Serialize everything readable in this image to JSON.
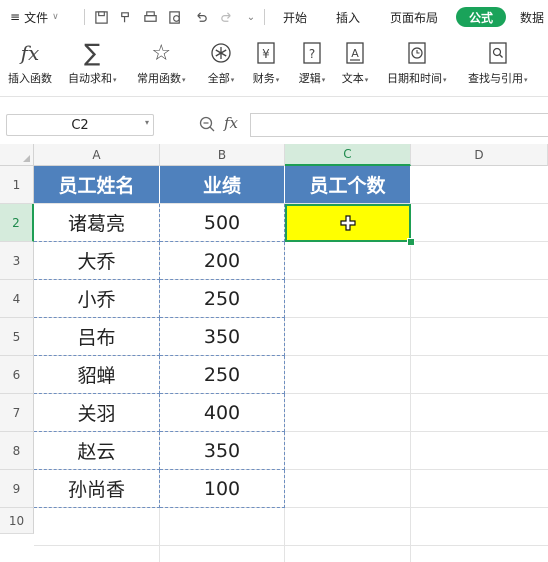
{
  "menubar": {
    "file_label": "文件",
    "tabs": [
      "开始",
      "插入",
      "页面布局",
      "公式",
      "数据"
    ],
    "active_tab": "公式",
    "quick_access": [
      "save-icon",
      "format-painter-icon",
      "print-icon",
      "print-preview-icon",
      "undo-icon",
      "redo-icon",
      "more-icon"
    ]
  },
  "ribbon": {
    "buttons": [
      {
        "label": "插入函数",
        "icon": "fx-icon",
        "dropdown": false
      },
      {
        "label": "自动求和",
        "icon": "sigma-icon",
        "dropdown": true
      },
      {
        "label": "常用函数",
        "icon": "star-icon",
        "dropdown": true
      },
      {
        "label": "全部",
        "icon": "asterisk-icon",
        "dropdown": true
      },
      {
        "label": "财务",
        "icon": "yen-icon",
        "dropdown": true
      },
      {
        "label": "逻辑",
        "icon": "question-icon",
        "dropdown": true
      },
      {
        "label": "文本",
        "icon": "text-icon",
        "dropdown": true
      },
      {
        "label": "日期和时间",
        "icon": "clock-icon",
        "dropdown": true
      },
      {
        "label": "查找与引用",
        "icon": "search-reference-icon",
        "dropdown": true
      }
    ]
  },
  "formula_bar": {
    "name_box": "C2",
    "fx_label": "fx",
    "formula": ""
  },
  "sheet": {
    "columns": [
      "A",
      "B",
      "C",
      "D"
    ],
    "selected_column": "C",
    "rows": [
      "1",
      "2",
      "3",
      "4",
      "5",
      "6",
      "7",
      "8",
      "9",
      "10"
    ],
    "selected_row": "2",
    "headers": [
      "员工姓名",
      "业绩",
      "员工个数"
    ],
    "data": [
      {
        "name": "诸葛亮",
        "score": "500"
      },
      {
        "name": "大乔",
        "score": "200"
      },
      {
        "name": "小乔",
        "score": "250"
      },
      {
        "name": "吕布",
        "score": "350"
      },
      {
        "name": "貂蝉",
        "score": "250"
      },
      {
        "name": "关羽",
        "score": "400"
      },
      {
        "name": "赵云",
        "score": "350"
      },
      {
        "name": "孙尚香",
        "score": "100"
      }
    ],
    "selected_cell": "C2",
    "header_fill": "#4f81bd",
    "selected_fill": "#ffff00",
    "selection_border": "#1e9e54"
  }
}
